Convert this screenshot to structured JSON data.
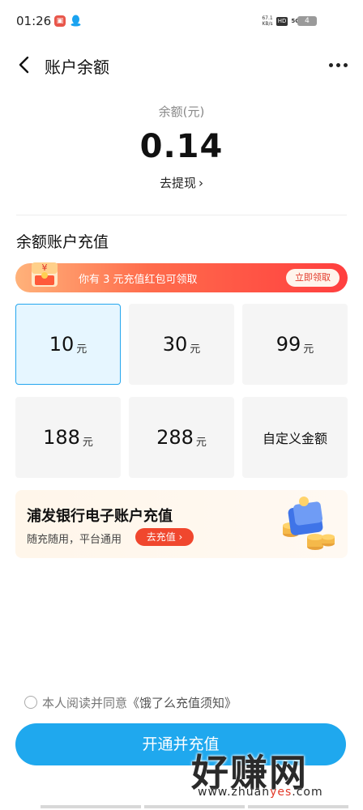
{
  "status_bar": {
    "time": "01:26",
    "net_speed_value": "67.1",
    "net_speed_unit": "KB/s",
    "hd": "HD",
    "network": "5G",
    "battery": "4"
  },
  "header": {
    "title": "账户余额",
    "back_icon": "chevron-left-icon",
    "more_icon": "more-horizontal-icon"
  },
  "balance": {
    "label": "余额(元)",
    "value": "0.14",
    "withdraw_label": "去提现",
    "withdraw_chevron": "›"
  },
  "recharge": {
    "section_title": "余额账户充值",
    "promo": {
      "icon": "red-packet-icon",
      "icon_symbol": "¥",
      "text": "你有 3 元充值红包可领取",
      "button": "立即领取"
    },
    "options": [
      {
        "amount": "10",
        "unit": "元",
        "selected": true
      },
      {
        "amount": "30",
        "unit": "元",
        "selected": false
      },
      {
        "amount": "99",
        "unit": "元",
        "selected": false
      },
      {
        "amount": "188",
        "unit": "元",
        "selected": false
      },
      {
        "amount": "288",
        "unit": "元",
        "selected": false
      }
    ],
    "custom_label": "自定义金额",
    "bank": {
      "title": "浦发银行电子账户充值",
      "subtitle": "随充随用，平台通用",
      "button": "去充值 ›",
      "icon": "wallet-coins-icon"
    }
  },
  "agreement": {
    "prefix": "本人阅读并同意",
    "link": "《饿了么充值须知》"
  },
  "primary_button": "开通并充值",
  "watermark": {
    "big": "好赚网",
    "small_prefix": "www.zhuan",
    "small_highlight": "yes",
    "small_suffix": ".com"
  },
  "colors": {
    "accent": "#1fa8ee",
    "selected_border": "#25a6ee",
    "promo_red": "#ff3f3f",
    "bank_button": "#f0472e"
  }
}
